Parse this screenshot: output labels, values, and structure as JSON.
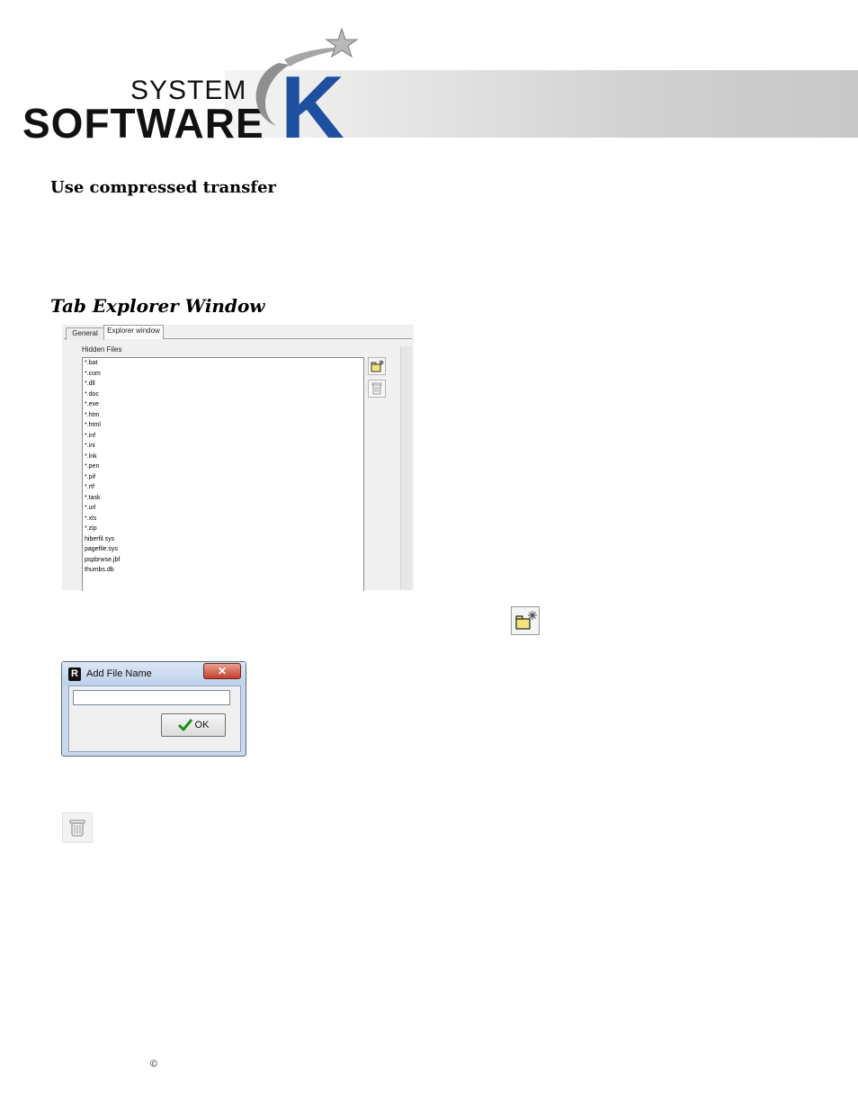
{
  "logo": {
    "system": "SYSTEM",
    "software": "SOFTWARE",
    "letter": "K"
  },
  "headings": {
    "compressed": "Use compressed transfer",
    "tab_explorer": "Tab Explorer Window"
  },
  "explorer_panel": {
    "tabs": [
      "General",
      "Explorer window"
    ],
    "group_label": "Hidden Files",
    "files": [
      "*.bat",
      "*.com",
      "*.dll",
      "*.doc",
      "*.exe",
      "*.htm",
      "*.html",
      "*.inf",
      "*.ini",
      "*.lnk",
      "*.pen",
      "*.pif",
      "*.rtf",
      "*.task",
      "*.url",
      "*.xls",
      "*.zip",
      "hiberfil.sys",
      "pagefile.sys",
      "pspbrwse.jbf",
      "thumbs.db"
    ],
    "icons": {
      "add": "add-folder-icon",
      "delete": "trash-icon"
    }
  },
  "dialog": {
    "icon_letter": "R",
    "title": "Add File Name",
    "close_glyph": "✕",
    "input_value": "",
    "ok_label": "OK"
  },
  "footer": {
    "copyright": "©"
  },
  "colors": {
    "brand_blue": "#1f4fa0",
    "ok_check_green": "#1a8f1a"
  }
}
